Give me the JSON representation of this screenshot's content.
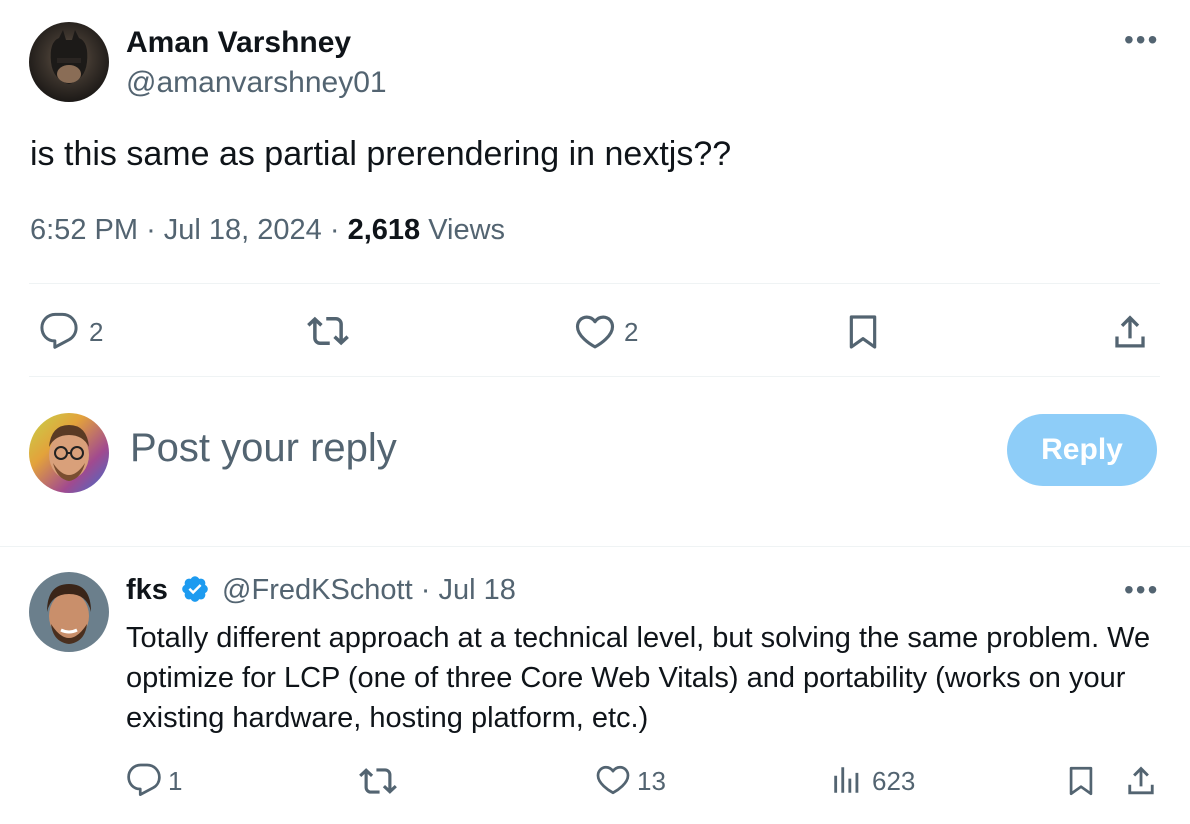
{
  "main_post": {
    "author_name": "Aman Varshney",
    "author_handle": "@amanvarshney01",
    "text": "is this same as partial prerendering in nextjs??",
    "time": "6:52 PM",
    "date": "Jul 18, 2024",
    "views_count": "2,618",
    "views_label": "Views",
    "actions": {
      "replies": "2",
      "likes": "2"
    }
  },
  "reply_composer": {
    "placeholder": "Post your reply",
    "button_label": "Reply"
  },
  "reply": {
    "author_name": "fks",
    "author_handle": "@FredKSchott",
    "date": "Jul 18",
    "text": "Totally different approach at a technical level, but solving the same problem. We optimize for LCP (one of three Core Web Vitals) and portability (works on your existing hardware, hosting platform, etc.)",
    "actions": {
      "replies": "1",
      "likes": "13",
      "views": "623"
    }
  },
  "colors": {
    "text": "#0f1419",
    "muted": "#536471",
    "reply_button_bg": "#8ecdf8",
    "verified_badge": "#1d9bf0",
    "divider": "#eff3f4"
  },
  "icons": [
    "more-icon",
    "reply-icon",
    "retweet-icon",
    "like-icon",
    "bookmark-icon",
    "share-icon",
    "views-icon",
    "verified-icon"
  ]
}
